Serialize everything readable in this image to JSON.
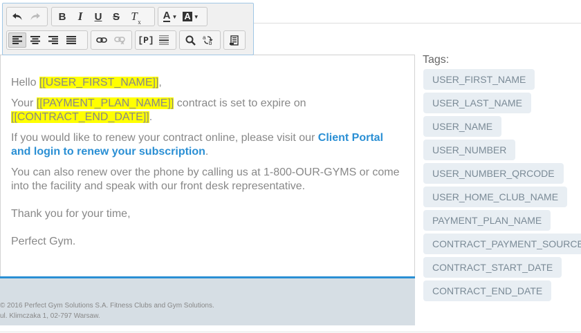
{
  "toolbar": {
    "row1": [
      {
        "name": "undo-button",
        "icon": "undo-icon",
        "disabled": false
      },
      {
        "name": "redo-button",
        "icon": "redo-icon",
        "disabled": true
      },
      {
        "name": "bold-button",
        "label": "B"
      },
      {
        "name": "italic-button",
        "label": "I"
      },
      {
        "name": "underline-button",
        "label": "U"
      },
      {
        "name": "strikethrough-button",
        "label": "S"
      },
      {
        "name": "remove-format-button",
        "label": "T"
      },
      {
        "name": "text-color-button",
        "label": "A"
      },
      {
        "name": "background-color-button",
        "label": "A"
      }
    ],
    "row2": [
      {
        "name": "align-left-button",
        "icon": "align-left-icon",
        "active": true
      },
      {
        "name": "align-center-button",
        "icon": "align-center-icon"
      },
      {
        "name": "align-right-button",
        "icon": "align-right-icon"
      },
      {
        "name": "justify-button",
        "icon": "justify-icon"
      },
      {
        "name": "link-button",
        "icon": "link-icon"
      },
      {
        "name": "unlink-button",
        "icon": "unlink-icon",
        "disabled": true
      },
      {
        "name": "placeholder-button",
        "label": "[P]"
      },
      {
        "name": "horizontal-line-button",
        "icon": "hr-icon"
      },
      {
        "name": "find-button",
        "icon": "search-icon"
      },
      {
        "name": "replace-button",
        "icon": "replace-icon"
      },
      {
        "name": "source-button",
        "icon": "source-icon"
      }
    ]
  },
  "editor": {
    "greeting": "Hello ",
    "first_name_tag": "[[USER_FIRST_NAME]]",
    "greeting_end": ",",
    "line2_prefix": "Your ",
    "plan_tag": "[[PAYMENT_PLAN_NAME]]",
    "line2_mid": " contract is set to expire on ",
    "end_date_tag": "[[CONTRACT_END_DATE]]",
    "line2_end": ".",
    "line3_prefix": "If you would like to renew your contract online, please visit our ",
    "line3_link": "Client Portal and login to renew your subscription",
    "line3_end": ".",
    "line4": "You can also renew over the phone by calling us at 1-800-OUR-GYMS or come into the facility and speak with our front desk representative.",
    "line5": "Thank you for your time,",
    "line6": "Perfect Gym."
  },
  "footer": {
    "line1": "© 2016 Perfect Gym Solutions S.A. Fitness Clubs and Gym Solutions.",
    "line2": "ul. Klimczaka 1, 02-797 Warsaw."
  },
  "tags": {
    "title": "Tags:",
    "items": [
      "USER_FIRST_NAME",
      "USER_LAST_NAME",
      "USER_NAME",
      "USER_NUMBER",
      "USER_NUMBER_QRCODE",
      "USER_HOME_CLUB_NAME",
      "PAYMENT_PLAN_NAME",
      "CONTRACT_PAYMENT_SOURCE",
      "CONTRACT_START_DATE",
      "CONTRACT_END_DATE"
    ]
  },
  "colors": {
    "highlight": "#ffff00",
    "link": "#2a8fd4",
    "footer_bg": "#d6dee4",
    "tag_bg": "#e8eef3"
  }
}
